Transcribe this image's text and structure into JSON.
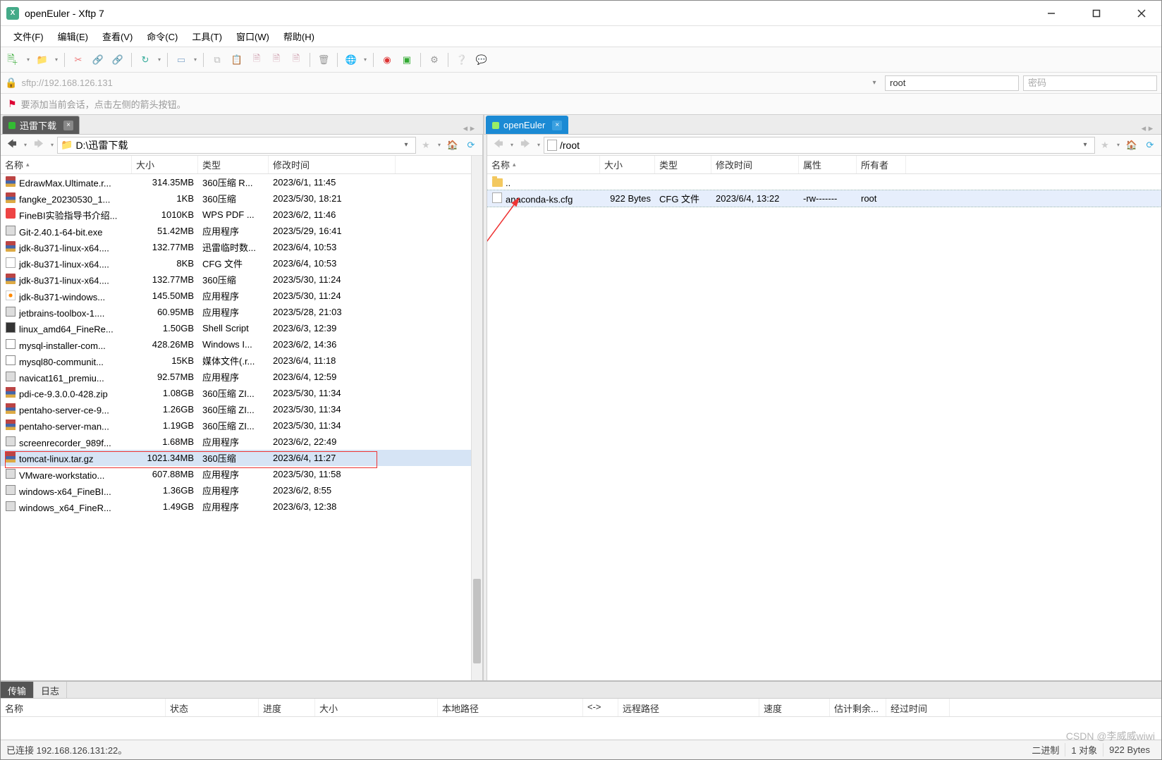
{
  "title": "openEuler - Xftp 7",
  "menu": [
    "文件(F)",
    "编辑(E)",
    "查看(V)",
    "命令(C)",
    "工具(T)",
    "窗口(W)",
    "帮助(H)"
  ],
  "addr": {
    "url": "sftp://192.168.126.131",
    "user_value": "root",
    "pass_placeholder": "密码"
  },
  "hint": "要添加当前会话，点击左侧的箭头按钮。",
  "tabs": {
    "left": "迅雷下载",
    "right": "openEuler"
  },
  "left": {
    "path": "D:\\迅雷下载",
    "cols": [
      "名称",
      "大小",
      "类型",
      "修改时间"
    ],
    "files": [
      {
        "icon": "rar",
        "name": "EdrawMax.Ultimate.r...",
        "size": "314.35MB",
        "type": "360压缩 R...",
        "date": "2023/6/1, 11:45"
      },
      {
        "icon": "rar",
        "name": "fangke_20230530_1...",
        "size": "1KB",
        "type": "360压缩",
        "date": "2023/5/30, 18:21"
      },
      {
        "icon": "pdf",
        "name": "FineBI实验指导书介绍...",
        "size": "1010KB",
        "type": "WPS PDF ...",
        "date": "2023/6/2, 11:46"
      },
      {
        "icon": "exe",
        "name": "Git-2.40.1-64-bit.exe",
        "size": "51.42MB",
        "type": "应用程序",
        "date": "2023/5/29, 16:41"
      },
      {
        "icon": "rar",
        "name": "jdk-8u371-linux-x64....",
        "size": "132.77MB",
        "type": "迅雷临时数...",
        "date": "2023/6/4, 10:53"
      },
      {
        "icon": "txt",
        "name": "jdk-8u371-linux-x64....",
        "size": "8KB",
        "type": "CFG 文件",
        "date": "2023/6/4, 10:53"
      },
      {
        "icon": "rar",
        "name": "jdk-8u371-linux-x64....",
        "size": "132.77MB",
        "type": "360压缩",
        "date": "2023/5/30, 11:24"
      },
      {
        "icon": "java",
        "name": "jdk-8u371-windows...",
        "size": "145.50MB",
        "type": "应用程序",
        "date": "2023/5/30, 11:24"
      },
      {
        "icon": "exe",
        "name": "jetbrains-toolbox-1....",
        "size": "60.95MB",
        "type": "应用程序",
        "date": "2023/5/28, 21:03"
      },
      {
        "icon": "sh",
        "name": "linux_amd64_FineRe...",
        "size": "1.50GB",
        "type": "Shell Script",
        "date": "2023/6/3, 12:39"
      },
      {
        "icon": "msi",
        "name": "mysql-installer-com...",
        "size": "428.26MB",
        "type": "Windows I...",
        "date": "2023/6/2, 14:36"
      },
      {
        "icon": "db",
        "name": "mysql80-communit...",
        "size": "15KB",
        "type": "媒体文件(.r...",
        "date": "2023/6/4, 11:18"
      },
      {
        "icon": "exe",
        "name": "navicat161_premiu...",
        "size": "92.57MB",
        "type": "应用程序",
        "date": "2023/6/4, 12:59"
      },
      {
        "icon": "zip",
        "name": "pdi-ce-9.3.0.0-428.zip",
        "size": "1.08GB",
        "type": "360压缩 ZI...",
        "date": "2023/5/30, 11:34"
      },
      {
        "icon": "zip",
        "name": "pentaho-server-ce-9...",
        "size": "1.26GB",
        "type": "360压缩 ZI...",
        "date": "2023/5/30, 11:34"
      },
      {
        "icon": "zip",
        "name": "pentaho-server-man...",
        "size": "1.19GB",
        "type": "360压缩 ZI...",
        "date": "2023/5/30, 11:34"
      },
      {
        "icon": "exe",
        "name": "screenrecorder_989f...",
        "size": "1.68MB",
        "type": "应用程序",
        "date": "2023/6/2, 22:49"
      },
      {
        "icon": "zip",
        "name": "tomcat-linux.tar.gz",
        "size": "1021.34MB",
        "type": "360压缩",
        "date": "2023/6/4, 11:27",
        "selected": true
      },
      {
        "icon": "exe",
        "name": "VMware-workstatio...",
        "size": "607.88MB",
        "type": "应用程序",
        "date": "2023/5/30, 11:58"
      },
      {
        "icon": "exe",
        "name": "windows-x64_FineBI...",
        "size": "1.36GB",
        "type": "应用程序",
        "date": "2023/6/2, 8:55"
      },
      {
        "icon": "exe",
        "name": "windows_x64_FineR...",
        "size": "1.49GB",
        "type": "应用程序",
        "date": "2023/6/3, 12:38"
      }
    ]
  },
  "right": {
    "path": "/root",
    "cols": [
      "名称",
      "大小",
      "类型",
      "修改时间",
      "属性",
      "所有者"
    ],
    "parent": "..",
    "files": [
      {
        "icon": "txt",
        "name": "anaconda-ks.cfg",
        "size": "922 Bytes",
        "type": "CFG 文件",
        "date": "2023/6/4, 13:22",
        "attr": "-rw-------",
        "owner": "root",
        "selected": true
      }
    ]
  },
  "bottom": {
    "tabs": [
      "传输",
      "日志"
    ],
    "cols": [
      "名称",
      "状态",
      "进度",
      "大小",
      "本地路径",
      "<->",
      "远程路径",
      "速度",
      "估计剩余...",
      "经过时间"
    ]
  },
  "status": {
    "conn": "已连接 192.168.126.131:22。",
    "mode": "二进制",
    "sel": "1 对象",
    "bytes": "922 Bytes"
  },
  "watermark": "CSDN @李威威wiwi"
}
